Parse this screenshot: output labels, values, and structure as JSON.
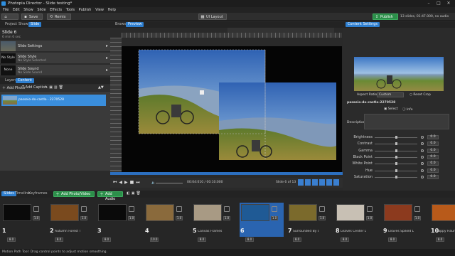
{
  "window": {
    "title": "Photopia Director - Slide testing*"
  },
  "menu": [
    "File",
    "Edit",
    "Show",
    "Slide",
    "Effects",
    "Tools",
    "Publish",
    "View",
    "Help"
  ],
  "toolbar": {
    "home": "",
    "save": "Save",
    "remix": "Remix",
    "layout": "UI Layout",
    "publish": "Publish",
    "info": "13 slides, 01:47.000, no audio"
  },
  "left": {
    "tabs": [
      "Project",
      "Show",
      "Slide"
    ],
    "slide_title": "Slide 6",
    "slide_sub": "6 min 6 sec",
    "items": [
      {
        "thumb": "",
        "l1": "Slide Settings",
        "l2": ""
      },
      {
        "thumb": "No Style",
        "l1": "Slide Style",
        "l2": "No Style Selected"
      },
      {
        "thumb": "None",
        "l1": "Slide Sound",
        "l2": "No Slide Sound"
      }
    ],
    "layer_tabs": [
      "Layers",
      "Content"
    ],
    "layer_actions": {
      "add_photo": "Add Photo",
      "add_caption": "Add Caption"
    },
    "layer_name": "passeio-do-castlo - 2270528"
  },
  "preview": {
    "tabs": [
      "Browser",
      "Preview"
    ],
    "time": "00:04:010 / 00:10:000",
    "slide_of": "Slide 6 of 13"
  },
  "right": {
    "tab": "Content Settings",
    "aspect_label": "Aspect Ratio",
    "aspect_value": "Custom",
    "reset_crop": "Reset Crop",
    "filename": "passeio-do-castlo-2270528",
    "select": "Select",
    "info": "Info",
    "description": "Description",
    "sliders": [
      {
        "name": "Brightness",
        "value": "0.0",
        "pos": 0.5
      },
      {
        "name": "Contrast",
        "value": "0.0",
        "pos": 0.5
      },
      {
        "name": "Gamma",
        "value": "0.0",
        "pos": 0.5
      },
      {
        "name": "Black Point",
        "value": "0.0",
        "pos": 0.5
      },
      {
        "name": "White Point",
        "value": "0.0",
        "pos": 0.5
      },
      {
        "name": "Hue",
        "value": "0.0",
        "pos": 0.5
      },
      {
        "name": "Saturation",
        "value": "0.0",
        "pos": 0.5
      }
    ]
  },
  "timeline": {
    "tabs": [
      "Slides",
      "Timeline",
      "Keyframes"
    ],
    "add_photo": "Add Photo/Video",
    "add_audio": "Add Audio",
    "clips": [
      {
        "num": "1",
        "name": "",
        "dur": "8.0",
        "tdur": "1.0",
        "color": "#0a0a0a"
      },
      {
        "num": "2",
        "name": "Autumn Forest Tit",
        "dur": "8.0",
        "tdur": "1.0",
        "color": "#7a4a1e"
      },
      {
        "num": "3",
        "name": "",
        "dur": "8.0",
        "tdur": "1.0",
        "color": "#0a0a0a"
      },
      {
        "num": "4",
        "name": "",
        "dur": "10.0",
        "tdur": "1.0",
        "color": "#8a6a3c"
      },
      {
        "num": "5",
        "name": "Canvas Frames - Right N",
        "dur": "8.0",
        "tdur": "1.0",
        "color": "#a89a84"
      },
      {
        "num": "6",
        "name": "",
        "dur": "8.0",
        "tdur": "1.0",
        "color": "#1f5a95"
      },
      {
        "num": "7",
        "name": "Surrounded By Lea",
        "dur": "8.0",
        "tdur": "1.0",
        "color": "#7b6a2c"
      },
      {
        "num": "8",
        "name": "Leaves Center Lin",
        "dur": "8.0",
        "tdur": "1.0",
        "color": "#c8c0b4"
      },
      {
        "num": "9",
        "name": "Leaves Spiked Lat",
        "dur": "8.0",
        "tdur": "1.0",
        "color": "#8c3a1e"
      },
      {
        "num": "10",
        "name": "Happy Hauntin",
        "dur": "8.0",
        "tdur": "1.0",
        "color": "#b85a1a"
      }
    ]
  },
  "status": "Motion Path Tool: Drag control points to adjust motion smoothing."
}
